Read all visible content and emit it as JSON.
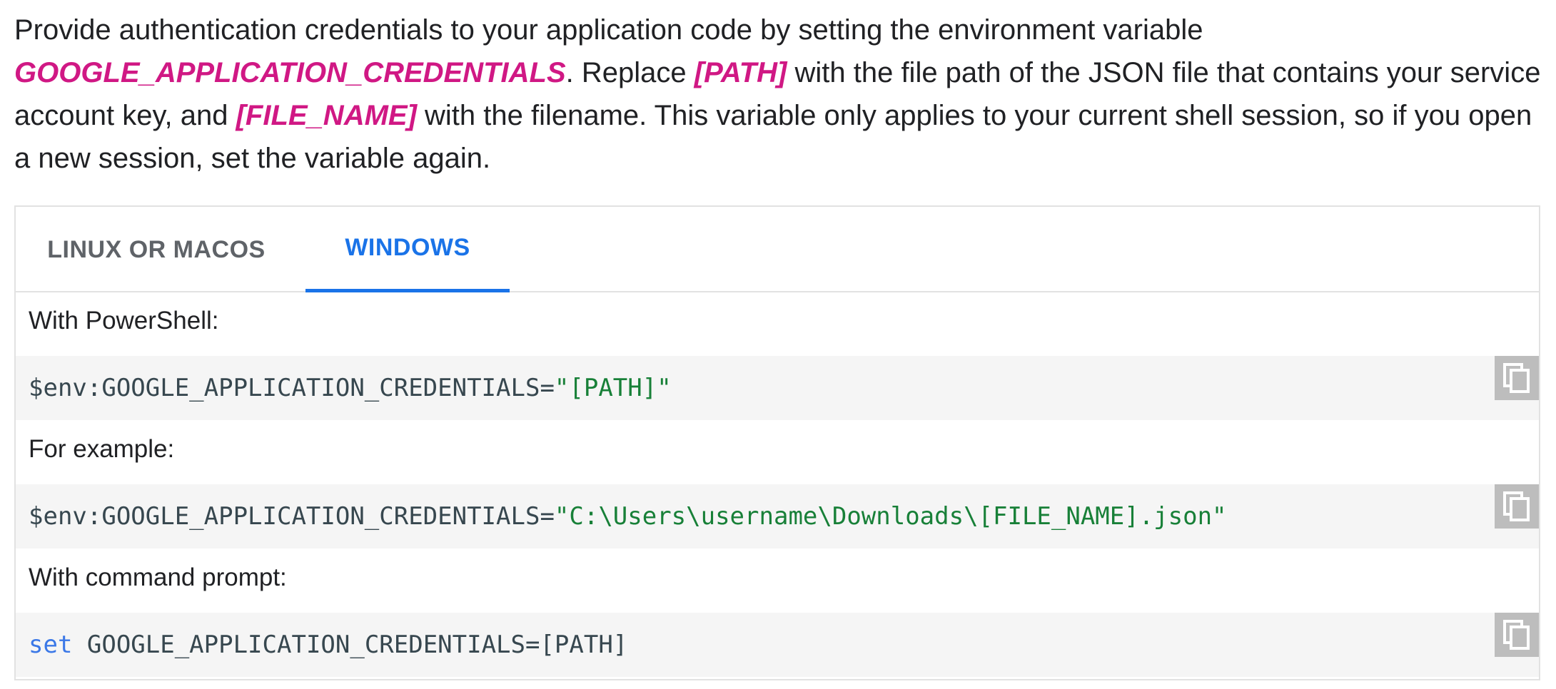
{
  "intro": {
    "part1": "Provide authentication credentials to your application code by setting the environment variable ",
    "var_env": "GOOGLE_APPLICATION_CREDENTIALS",
    "part2": ". Replace ",
    "var_path": "[PATH]",
    "part3": " with the file path of the JSON file that contains your service account key, and ",
    "var_file": "[FILE_NAME]",
    "part4": " with the filename. This variable only applies to your current shell session, so if you open a new session, set the variable again."
  },
  "tabs": [
    {
      "label": "LINUX OR MACOS",
      "active": false
    },
    {
      "label": "WINDOWS",
      "active": true
    }
  ],
  "content": {
    "powershell_label": "With PowerShell:",
    "code1": {
      "prefix": "$env:GOOGLE_APPLICATION_CREDENTIALS=",
      "string": "\"[PATH]\""
    },
    "example_label": "For example:",
    "code2": {
      "prefix": "$env:GOOGLE_APPLICATION_CREDENTIALS=",
      "string": "\"C:\\Users\\username\\Downloads\\[FILE_NAME].json\""
    },
    "cmd_label": "With command prompt:",
    "code3": {
      "keyword": "set",
      "rest": " GOOGLE_APPLICATION_CREDENTIALS=[PATH]"
    }
  },
  "icons": {
    "copy": "copy-icon"
  },
  "colors": {
    "accent": "#1a73e8",
    "variable": "#d01884",
    "string": "#188038",
    "keyword": "#3b78e7"
  }
}
